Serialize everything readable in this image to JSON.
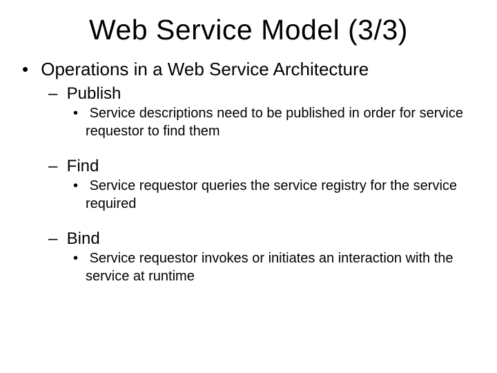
{
  "title": "Web Service Model (3/3)",
  "main_bullet": "Operations in a Web Service Architecture",
  "sections": [
    {
      "heading": "Publish",
      "detail": "Service descriptions need to be published in order for service requestor to find them"
    },
    {
      "heading": "Find",
      "detail": "Service requestor queries the service registry for the service required"
    },
    {
      "heading": "Bind",
      "detail": "Service requestor invokes or initiates an interaction with the service at runtime"
    }
  ]
}
